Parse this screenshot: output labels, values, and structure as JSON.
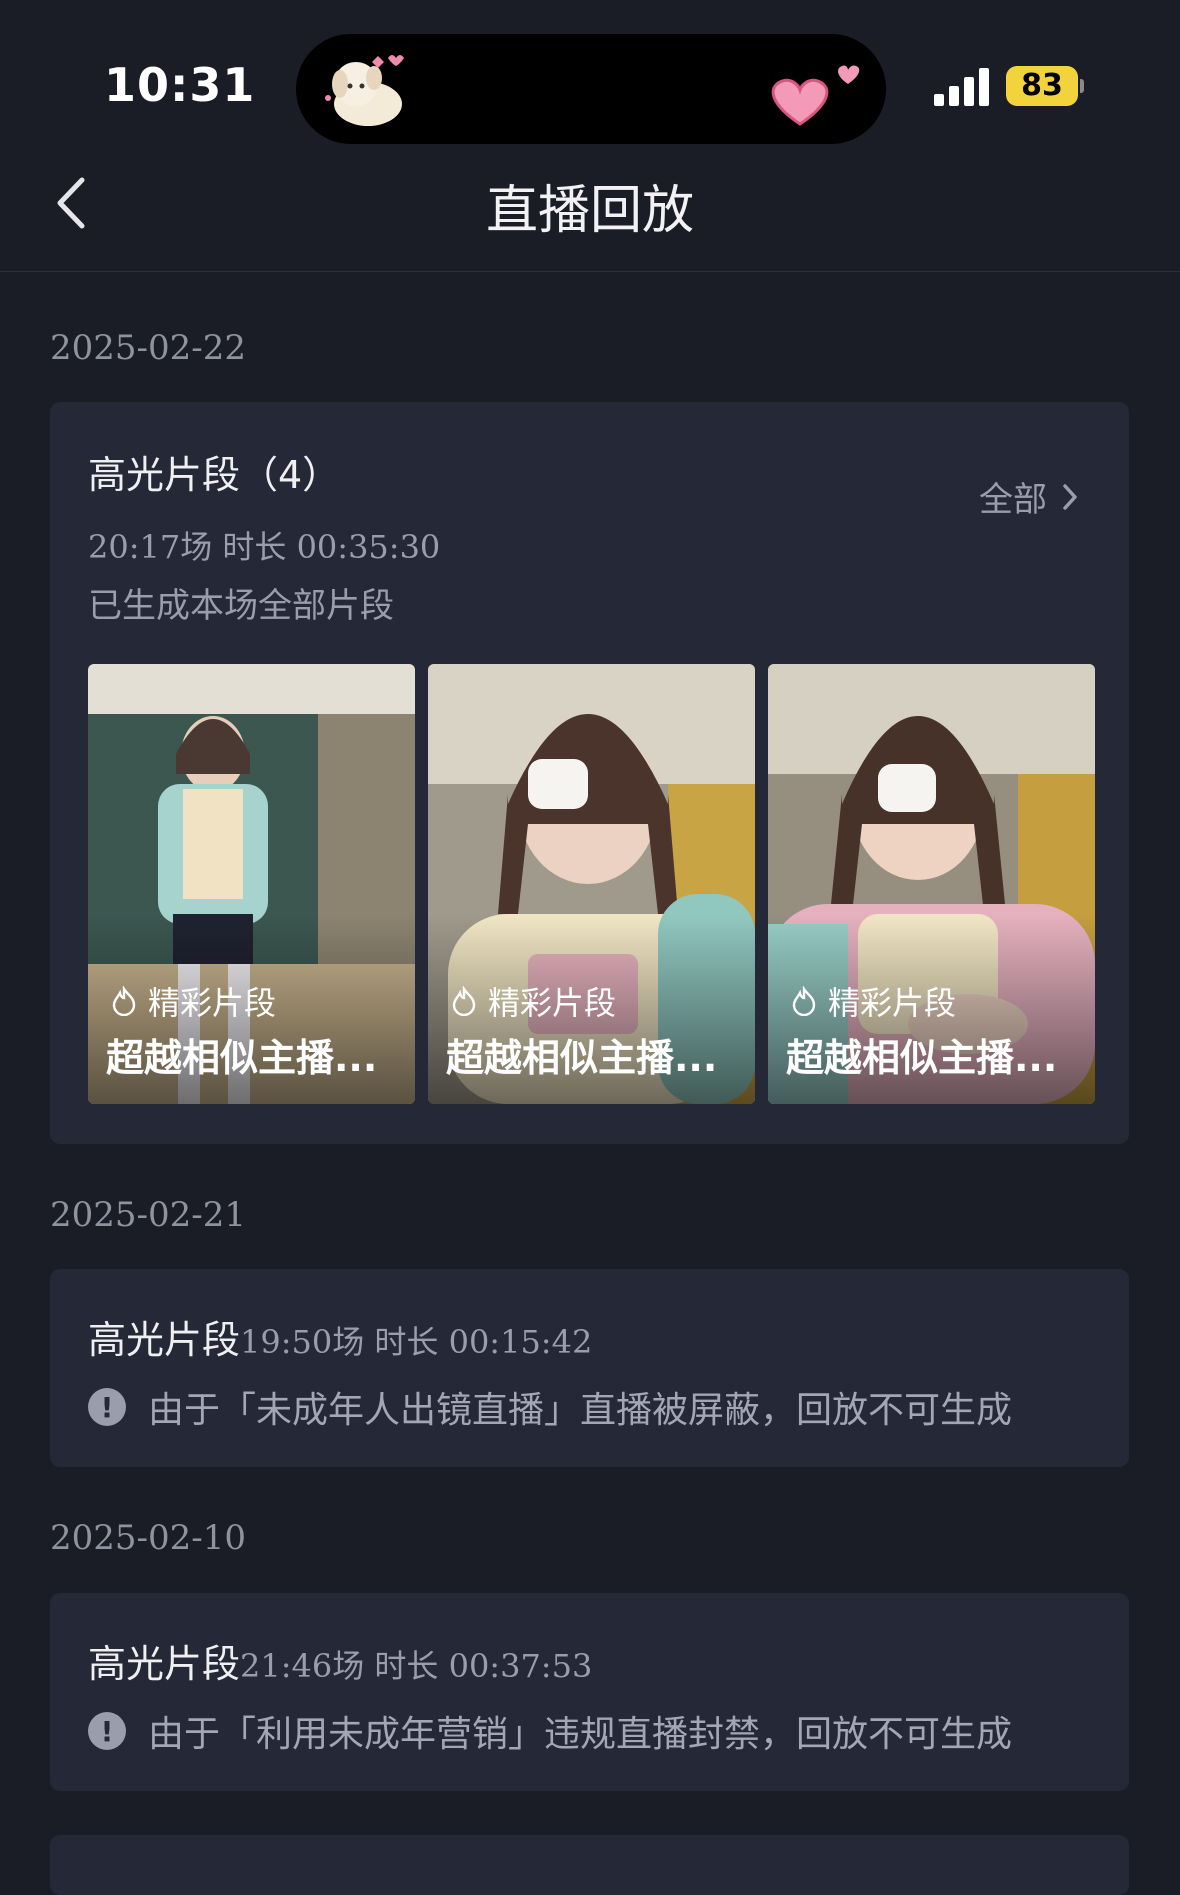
{
  "status_bar": {
    "time": "10:31",
    "battery": "83"
  },
  "header": {
    "title": "直播回放"
  },
  "sections": [
    {
      "date": "2025-02-22",
      "card": {
        "title": "高光片段（4）",
        "all_label": "全部",
        "meta": "20:17场 时长 00:35:30",
        "status": "已生成本场全部片段",
        "clips": [
          {
            "tag": "精彩片段",
            "caption": "超越相似主播..."
          },
          {
            "tag": "精彩片段",
            "caption": "超越相似主播..."
          },
          {
            "tag": "精彩片段",
            "caption": "超越相似主播..."
          }
        ]
      }
    },
    {
      "date": "2025-02-21",
      "card": {
        "title": "高光片段",
        "meta": "19:50场 时长 00:15:42",
        "warning": "由于「未成年人出镜直播」直播被屏蔽，回放不可生成"
      }
    },
    {
      "date": "2025-02-10",
      "card": {
        "title": "高光片段",
        "meta": "21:46场 时长 00:37:53",
        "warning": "由于「利用未成年营销」违规直播封禁，回放不可生成"
      }
    }
  ],
  "colors": {
    "background": "#1a1c26",
    "card": "#252836",
    "muted_text": "#9a9dac",
    "battery": "#f3d33b"
  }
}
